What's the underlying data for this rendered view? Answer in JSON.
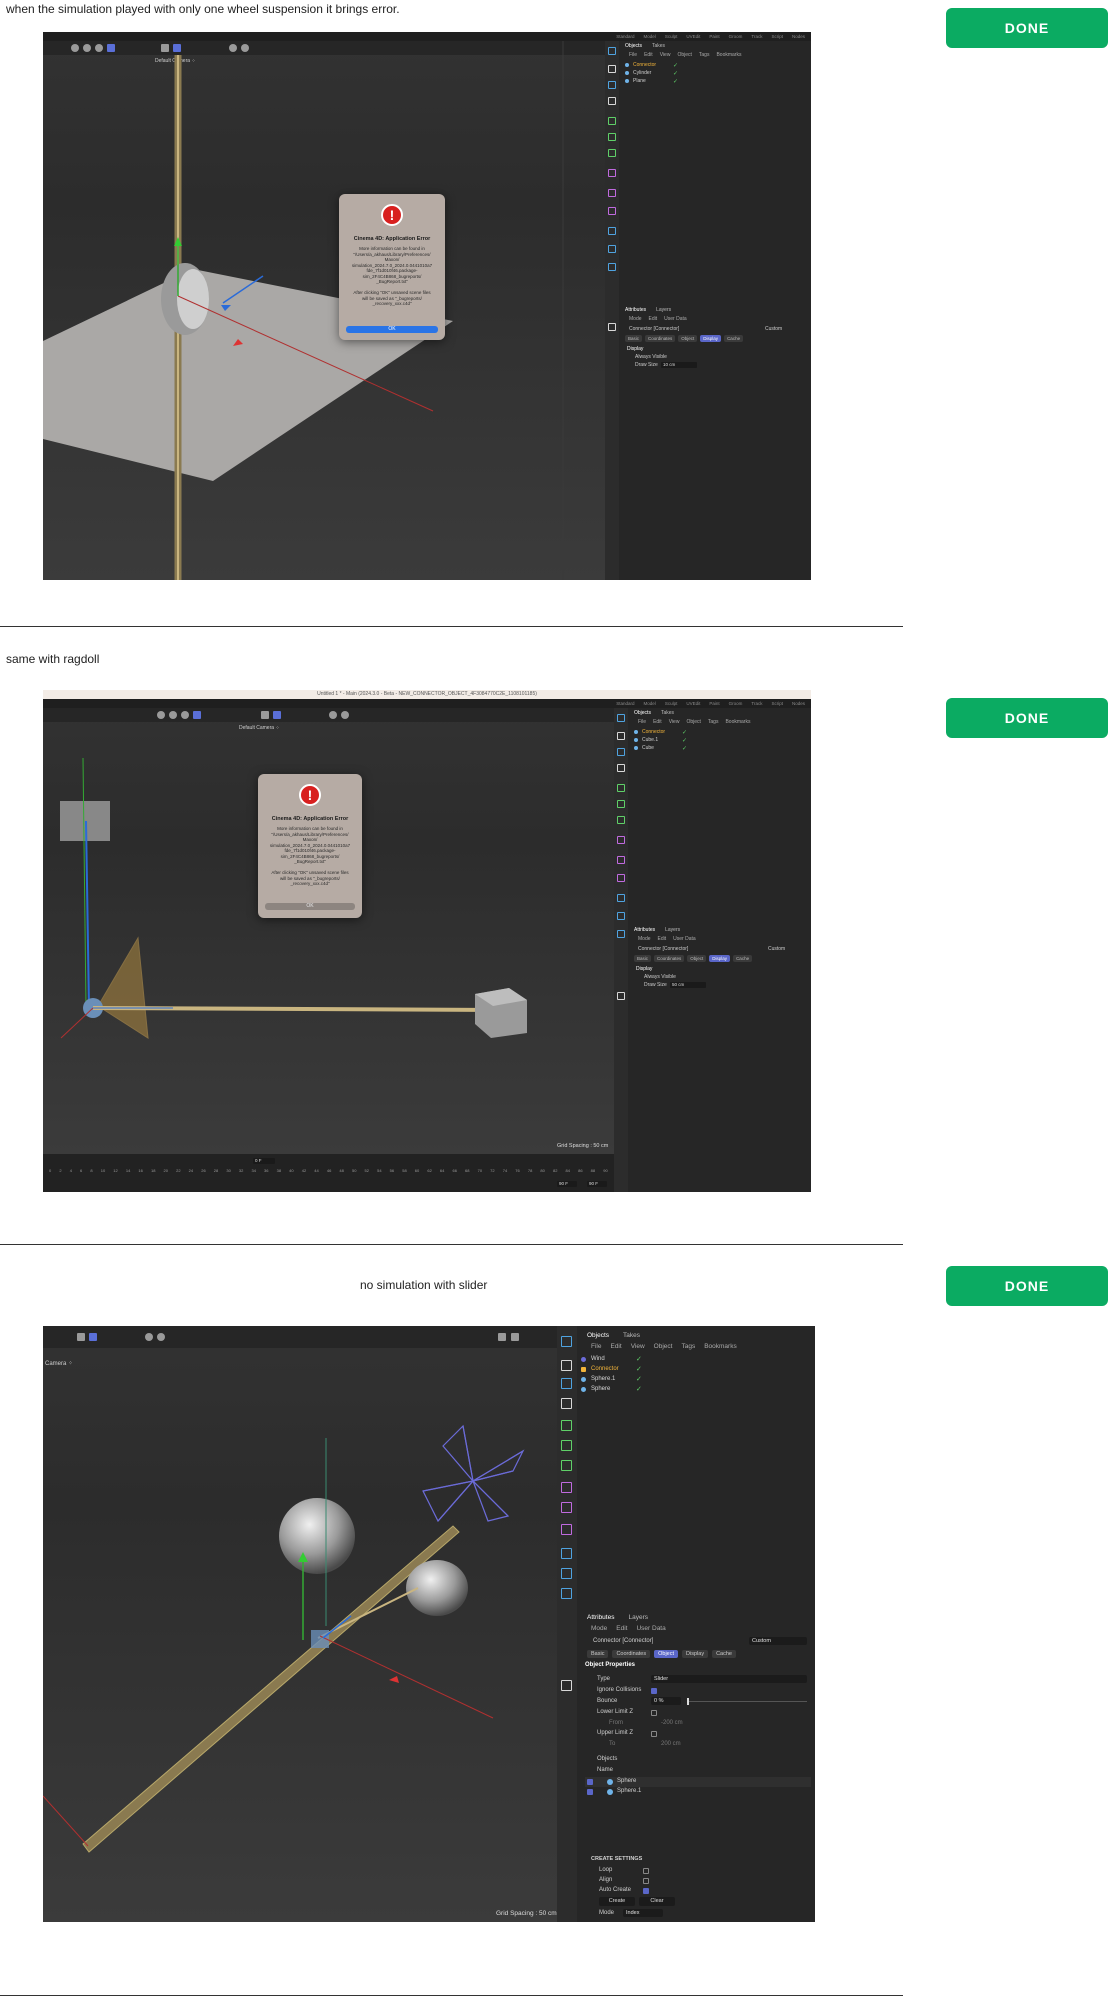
{
  "sections": [
    {
      "caption": "when the simulation played with only one wheel suspension it brings error.",
      "done_label": "DONE",
      "layouts": [
        "Standard",
        "Model",
        "Sculpt",
        "UVEdit",
        "Paint",
        "Groom",
        "Track",
        "Script",
        "Nodes"
      ],
      "camera_label": "Default Camera ⁘",
      "panel_tabs": [
        "Objects",
        "Takes"
      ],
      "menu": [
        "File",
        "Edit",
        "View",
        "Object",
        "Tags",
        "Bookmarks"
      ],
      "objects": [
        "Connector",
        "Cylinder",
        "Plane"
      ],
      "attr_tabs": [
        "Attributes",
        "Layers"
      ],
      "attr_menu": [
        "Mode",
        "Edit",
        "User Data"
      ],
      "attr_object": "Connector [Connector]",
      "attr_preset": "Custom",
      "attr_subtabs": [
        "Basic",
        "Coordinates",
        "Object",
        "Display",
        "Cache"
      ],
      "section_title": "Display",
      "always_visible_label": "Always Visible",
      "draw_size_label": "Draw Size",
      "draw_size_value": "10 cm",
      "dialog": {
        "title": "Cinema 4D: Application Error",
        "body": "More information can be found in\n\"/Users/a_akhaus/Library/Preferences/\nMaxon/\nsimulation_2024.7.0_2024.0.0441010a7\nfde_7f1d010f46.package-\nsim_2F4C4B868_bugreports/\n_BugReport.txt\"\n\nAfter clicking \"OK\" unsaved scene files\nwill be saved as \"_bugreports/\n_recovery_xxx.c4d\"",
        "ok": "OK"
      }
    },
    {
      "caption": "same with ragdoll",
      "done_label": "DONE",
      "window_title": "Untitled 1 * - Main (2024.3.0 - Beta - NEW_CONNECTOR_OBJECT_4F3084770C2E_1108101185)",
      "layouts": [
        "Standard",
        "Model",
        "Sculpt",
        "UVEdit",
        "Paint",
        "Groom",
        "Track",
        "Script",
        "Nodes"
      ],
      "camera_label": "Default Camera ⁘",
      "panel_tabs": [
        "Objects",
        "Takes"
      ],
      "menu": [
        "File",
        "Edit",
        "View",
        "Object",
        "Tags",
        "Bookmarks"
      ],
      "objects": [
        "Connector",
        "Cube.1",
        "Cube"
      ],
      "attr_tabs": [
        "Attributes",
        "Layers"
      ],
      "attr_menu": [
        "Mode",
        "Edit",
        "User Data"
      ],
      "attr_object": "Connector [Connector]",
      "attr_preset": "Custom",
      "attr_subtabs": [
        "Basic",
        "Coordinates",
        "Object",
        "Display",
        "Cache"
      ],
      "section_title": "Display",
      "always_visible_label": "Always Visible",
      "draw_size_label": "Draw Size",
      "draw_size_value": "50 cm",
      "grid_spacing": "Grid Spacing : 50 cm",
      "frame_field": "0 F",
      "end_field": "90 F",
      "end_field2": "90 F",
      "ruler": [
        "0",
        "2",
        "4",
        "6",
        "8",
        "10",
        "12",
        "14",
        "16",
        "18",
        "20",
        "22",
        "24",
        "26",
        "28",
        "30",
        "32",
        "34",
        "36",
        "38",
        "40",
        "42",
        "44",
        "46",
        "48",
        "50",
        "52",
        "54",
        "56",
        "58",
        "60",
        "62",
        "64",
        "66",
        "68",
        "70",
        "72",
        "74",
        "76",
        "78",
        "80",
        "82",
        "84",
        "86",
        "88",
        "90"
      ],
      "dialog": {
        "title": "Cinema 4D: Application Error",
        "body": "More information can be found in\n\"/Users/a_akhaus/Library/Preferences/\nMaxon/\nsimulation_2024.7.0_2024.0.0441010a7\nfde_7f1d010f46.package-\nsim_2F4C4B868_bugreports/\n_BugReport.txt\"\n\nAfter clicking \"OK\" unsaved scene files\nwill be saved as \"_bugreports/\n_recovery_xxx.c4d\"",
        "ok": "OK"
      }
    },
    {
      "caption": "no simulation with slider",
      "done_label": "DONE",
      "camera_label": "Camera ⁘",
      "panel_tabs": [
        "Objects",
        "Takes"
      ],
      "menu": [
        "File",
        "Edit",
        "View",
        "Object",
        "Tags",
        "Bookmarks"
      ],
      "objects": [
        "Wind",
        "Connector",
        "Sphere.1",
        "Sphere"
      ],
      "attr_tabs": [
        "Attributes",
        "Layers"
      ],
      "attr_menu": [
        "Mode",
        "Edit",
        "User Data"
      ],
      "attr_object": "Connector [Connector]",
      "attr_preset": "Custom",
      "attr_subtabs": [
        "Basic",
        "Coordinates",
        "Object",
        "Display",
        "Cache"
      ],
      "section_title": "Object Properties",
      "props": {
        "type_label": "Type",
        "type_value": "Slider",
        "ignore_collisions": "Ignore Collisions",
        "bounce_label": "Bounce",
        "bounce_value": "0 %",
        "lower_limit_label": "Lower Limit Z",
        "from_label": "From",
        "from_value": "-200 cm",
        "upper_limit_label": "Upper Limit Z",
        "to_label": "To",
        "to_value": "200 cm",
        "objects_label": "Objects",
        "name_header": "Name",
        "object_list": [
          "Sphere",
          "Sphere.1"
        ]
      },
      "create": {
        "header": "CREATE SETTINGS",
        "loop": "Loop",
        "align": "Align",
        "auto_create": "Auto Create",
        "create_btn": "Create",
        "clear_btn": "Clear",
        "mode_label": "Mode",
        "mode_value": "Index"
      },
      "grid_spacing": "Grid Spacing : 50 cm"
    }
  ]
}
